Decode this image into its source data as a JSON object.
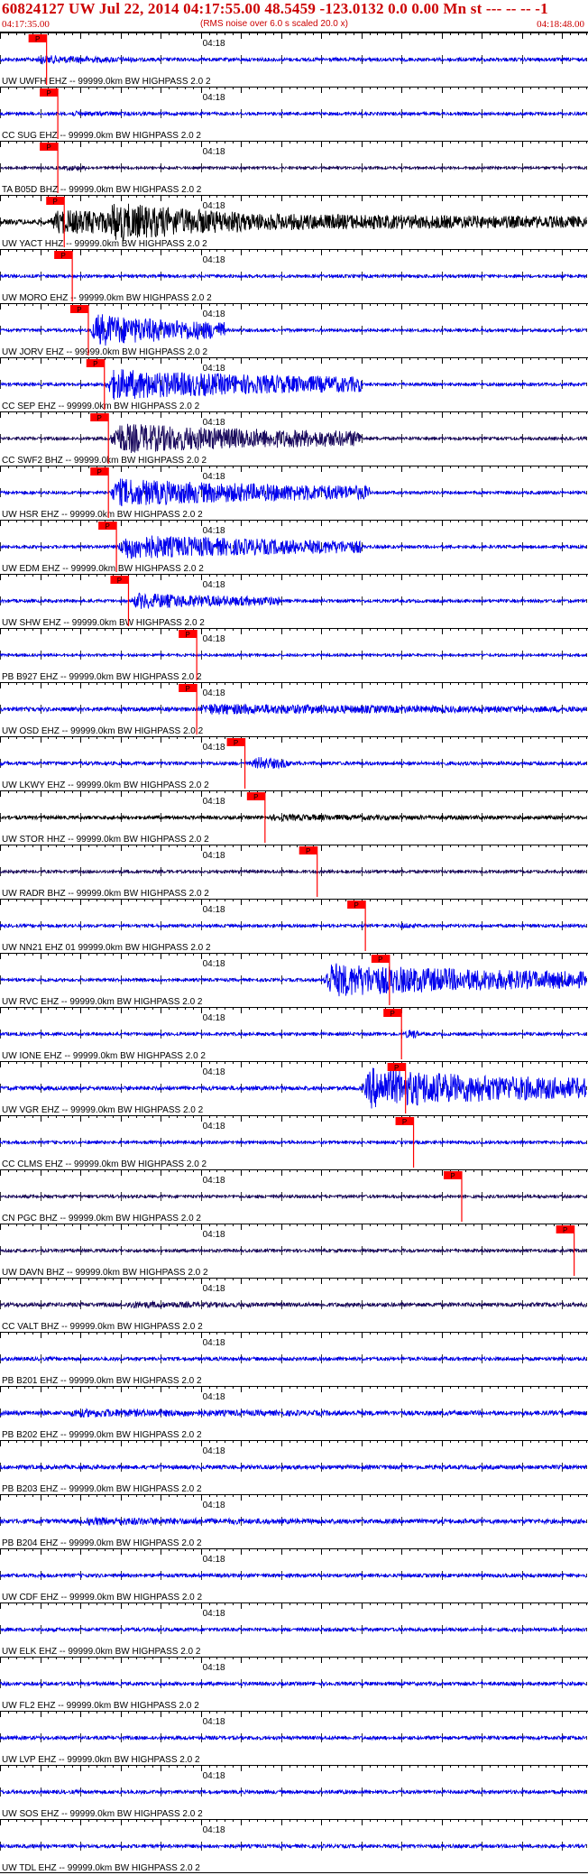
{
  "header": {
    "title": "60824127 UW Jul 22, 2014 04:17:55.00   48.5459 -123.0132  0.0 0.00 Mn st --- -- --  -1",
    "start_time": "04:17:35.00",
    "note": "(RMS noise over 6.0 s scaled 20.0 x)",
    "end_time": "04:18:48.00"
  },
  "colors": {
    "header_text": "#cc0000",
    "trace_blue": "#0000ee",
    "trace_black": "#000000",
    "trace_navy": "#1a0a5e",
    "pick_red": "#ff0000",
    "axis": "#000000"
  },
  "chart_data": {
    "type": "line",
    "title": "60824127 UW Jul 22, 2014 04:17:55.00   48.5459 -123.0132  0.0 0.00 Mn st --- -- --  -1",
    "x_range": [
      "04:17:35.00",
      "04:18:48.00"
    ],
    "x_range_seconds": [
      0,
      73
    ],
    "panel_time_label": "04:18",
    "panel_time_label_seconds": 25,
    "pick_label": "P",
    "traces": [
      {
        "name": "UW UWFH EHZ -- 99999.0km BW  HIGHPASS  2.0  2",
        "color": "blue",
        "pick": 5.8,
        "amp": 0.35,
        "bursts": [
          [
            4.0,
            17.0,
            3.0
          ]
        ]
      },
      {
        "name": "CC SUG EHZ -- 99999.0km BW  HIGHPASS  2.0  2",
        "color": "blue",
        "pick": 7.2,
        "amp": 0.3,
        "bursts": [
          [
            8.0,
            25.0,
            2.0
          ]
        ]
      },
      {
        "name": "TA B05D BHZ -- 99999.0km BW  HIGHPASS  2.0  2",
        "color": "navy",
        "pick": 7.2,
        "amp": 0.25,
        "bursts": [
          [
            7.5,
            11.0,
            3.5
          ]
        ]
      },
      {
        "name": "UW YACT HHZ -- 99999.0km BW  HIGHPASS  2.0  2",
        "color": "black",
        "pick": 8.0,
        "amp": 0.5,
        "bursts": [
          [
            6.0,
            73.0,
            5.0
          ],
          [
            13.0,
            30.0,
            9.0
          ]
        ]
      },
      {
        "name": "UW MORO EHZ -- 99999.0km BW  HIGHPASS  2.0  2",
        "color": "blue",
        "pick": 9.0,
        "amp": 0.3,
        "bursts": []
      },
      {
        "name": "UW JORV EHZ -- 99999.0km BW  HIGHPASS  2.0  2",
        "color": "blue",
        "pick": 11.0,
        "amp": 0.3,
        "bursts": [
          [
            11.0,
            28.0,
            12.0
          ]
        ]
      },
      {
        "name": "CC SEP EHZ -- 99999.0km BW  HIGHPASS  2.0  2",
        "color": "blue",
        "pick": 13.0,
        "amp": 0.3,
        "bursts": [
          [
            13.0,
            45.0,
            11.0
          ]
        ]
      },
      {
        "name": "CC SWF2 BHZ -- 99999.0km BW  HIGHPASS  2.0  2",
        "color": "navy",
        "pick": 13.5,
        "amp": 0.3,
        "bursts": [
          [
            13.5,
            45.0,
            11.0
          ]
        ]
      },
      {
        "name": "UW HSR EHZ -- 99999.0km BW  HIGHPASS  2.0  2",
        "color": "blue",
        "pick": 13.5,
        "amp": 0.3,
        "bursts": [
          [
            13.5,
            46.0,
            10.0
          ]
        ]
      },
      {
        "name": "UW EDM EHZ -- 99999.0km BW  HIGHPASS  2.0  2",
        "color": "blue",
        "pick": 14.5,
        "amp": 0.3,
        "bursts": [
          [
            14.5,
            45.0,
            9.0
          ]
        ]
      },
      {
        "name": "UW SHW EHZ -- 99999.0km BW  HIGHPASS  2.0  2",
        "color": "blue",
        "pick": 16.0,
        "amp": 0.3,
        "bursts": [
          [
            16.0,
            35.0,
            6.0
          ]
        ]
      },
      {
        "name": "PB B927 EHZ -- 99999.0km BW  HIGHPASS  2.0  2",
        "color": "blue",
        "pick": 24.5,
        "amp": 0.25,
        "bursts": []
      },
      {
        "name": "UW OSD EHZ -- 99999.0km BW  HIGHPASS  2.0  2",
        "color": "blue",
        "pick": 24.5,
        "amp": 0.4,
        "bursts": [
          [
            24.5,
            73.0,
            3.0
          ]
        ]
      },
      {
        "name": "UW LKWY EHZ -- 99999.0km BW  HIGHPASS  2.0  2",
        "color": "blue",
        "pick": 30.5,
        "amp": 0.35,
        "bursts": [
          [
            31.0,
            36.0,
            5.0
          ]
        ]
      },
      {
        "name": "UW STOR HHZ -- 99999.0km BW  HIGHPASS  2.0  2",
        "color": "black",
        "pick": 33.0,
        "amp": 0.35,
        "bursts": [
          [
            33.0,
            73.0,
            2.0
          ]
        ]
      },
      {
        "name": "UW RADR BHZ -- 99999.0km BW  HIGHPASS  2.0  2",
        "color": "navy",
        "pick": 39.5,
        "amp": 0.3,
        "bursts": []
      },
      {
        "name": "UW NN21 EHZ 01 99999.0km BW  HIGHPASS  2.0  2",
        "color": "blue",
        "pick": 45.5,
        "amp": 0.3,
        "bursts": [
          [
            49.0,
            52.0,
            3.0
          ]
        ]
      },
      {
        "name": "UW RVC EHZ -- 99999.0km BW  HIGHPASS  2.0  2",
        "color": "blue",
        "pick": 48.5,
        "amp": 0.3,
        "bursts": [
          [
            40.0,
            73.0,
            12.0
          ]
        ]
      },
      {
        "name": "UW IONE EHZ -- 99999.0km BW  HIGHPASS  2.0  2",
        "color": "blue",
        "pick": 50.0,
        "amp": 0.3,
        "bursts": [
          [
            50.0,
            52.0,
            6.0
          ]
        ]
      },
      {
        "name": "UW VGR EHZ -- 99999.0km BW  HIGHPASS  2.0  2",
        "color": "blue",
        "pick": 50.5,
        "amp": 0.4,
        "bursts": [
          [
            45.0,
            73.0,
            11.0
          ]
        ]
      },
      {
        "name": "CC CLMS EHZ -- 99999.0km BW  HIGHPASS  2.0  2",
        "color": "blue",
        "pick": 51.5,
        "amp": 0.3,
        "bursts": []
      },
      {
        "name": "CN PGC BHZ -- 99999.0km BW  HIGHPASS  2.0  2",
        "color": "navy",
        "pick": 57.5,
        "amp": 0.3,
        "bursts": []
      },
      {
        "name": "UW DAVN BHZ -- 99999.0km BW  HIGHPASS  2.0  2",
        "color": "navy",
        "pick": 71.5,
        "amp": 0.3,
        "bursts": []
      },
      {
        "name": "CC VALT BHZ -- 99999.0km BW  HIGHPASS  2.0  2",
        "color": "navy",
        "pick": null,
        "amp": 0.4,
        "bursts": [
          [
            15.0,
            40.0,
            2.0
          ]
        ]
      },
      {
        "name": "PB B201 EHZ -- 99999.0km BW  HIGHPASS  2.0  2",
        "color": "blue",
        "pick": null,
        "amp": 0.35,
        "bursts": []
      },
      {
        "name": "PB B202 EHZ -- 99999.0km BW  HIGHPASS  2.0  2",
        "color": "blue",
        "pick": null,
        "amp": 0.45,
        "bursts": [
          [
            8.0,
            60.0,
            2.0
          ]
        ]
      },
      {
        "name": "PB B203 EHZ -- 99999.0km BW  HIGHPASS  2.0  2",
        "color": "blue",
        "pick": null,
        "amp": 0.4,
        "bursts": []
      },
      {
        "name": "PB B204 EHZ -- 99999.0km BW  HIGHPASS  2.0  2",
        "color": "blue",
        "pick": null,
        "amp": 0.45,
        "bursts": [
          [
            10.0,
            50.0,
            2.0
          ]
        ]
      },
      {
        "name": "UW CDF EHZ -- 99999.0km BW  HIGHPASS  2.0  2",
        "color": "blue",
        "pick": null,
        "amp": 0.35,
        "bursts": []
      },
      {
        "name": "UW ELK EHZ -- 99999.0km BW  HIGHPASS  2.0  2",
        "color": "blue",
        "pick": null,
        "amp": 0.35,
        "bursts": []
      },
      {
        "name": "UW FL2 EHZ -- 99999.0km BW  HIGHPASS  2.0  2",
        "color": "blue",
        "pick": null,
        "amp": 0.35,
        "bursts": []
      },
      {
        "name": "UW LVP EHZ -- 99999.0km BW  HIGHPASS  2.0  2",
        "color": "blue",
        "pick": null,
        "amp": 0.35,
        "bursts": []
      },
      {
        "name": "UW SOS EHZ -- 99999.0km BW  HIGHPASS  2.0  2",
        "color": "blue",
        "pick": null,
        "amp": 0.35,
        "bursts": [
          [
            41.0,
            44.0,
            2.0
          ]
        ]
      },
      {
        "name": "UW TDL EHZ -- 99999.0km BW  HIGHPASS  2.0  2",
        "color": "blue",
        "pick": null,
        "amp": 0.35,
        "bursts": []
      }
    ]
  }
}
